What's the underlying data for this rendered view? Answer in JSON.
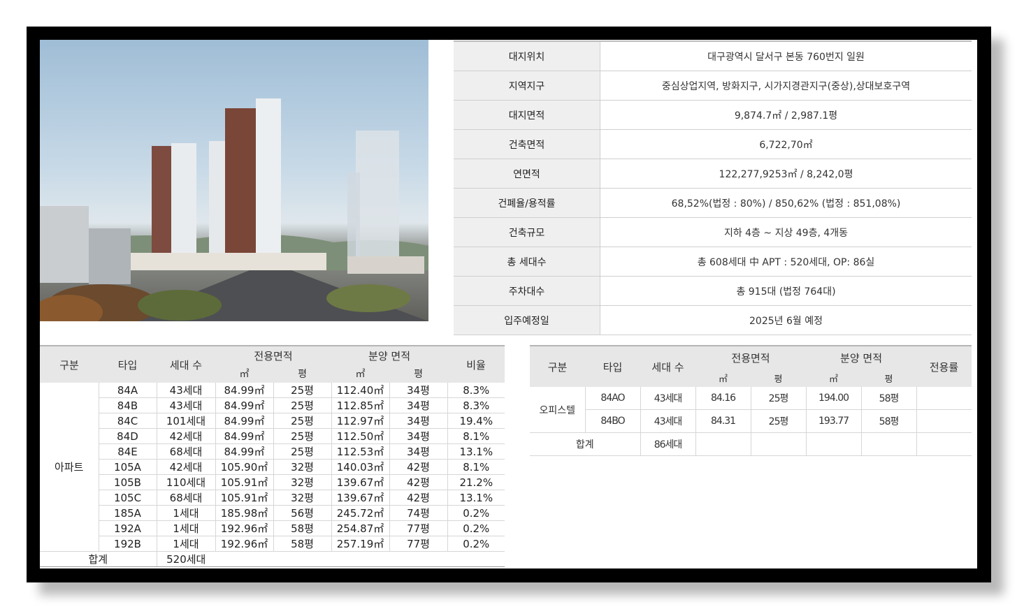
{
  "info_rows": [
    {
      "label": "대지위치",
      "value": "대구광역시 달서구 본동 760번지 일원"
    },
    {
      "label": "지역지구",
      "value": "중심상업지역, 방화지구, 시가지경관지구(중상),상대보호구역"
    },
    {
      "label": "대지면적",
      "value": "9,874.7㎡ / 2,987.1평"
    },
    {
      "label": "건축면적",
      "value": "6,722,70㎡"
    },
    {
      "label": "연면적",
      "value": "122,277,9253㎡ / 8,242,0평"
    },
    {
      "label": "건폐율/용적률",
      "value": "68,52%(법정 : 80%) / 850,62% (법정 : 851,08%)"
    },
    {
      "label": "건축규모",
      "value": "지하 4층 ~ 지상 49층, 4개동"
    },
    {
      "label": "총 세대수",
      "value": "총 608세대 中 APT : 520세대, OP: 86실"
    },
    {
      "label": "주차대수",
      "value": "총 915대 (법정 764대)"
    },
    {
      "label": "입주예정일",
      "value": "2025년 6월 예정"
    }
  ],
  "apt_table": {
    "headers": {
      "category": "구분",
      "type": "타입",
      "units": "세대 수",
      "exclusive": "전용면적",
      "supply": "분양 면적",
      "ratio": "비율",
      "sqm": "㎡",
      "pyeong": "평"
    },
    "group_label": "아파트",
    "rows": [
      [
        "84A",
        "43세대",
        "84.99㎡",
        "25평",
        "112.40㎡",
        "34평",
        "8.3%"
      ],
      [
        "84B",
        "43세대",
        "84.99㎡",
        "25평",
        "112.85㎡",
        "34평",
        "8.3%"
      ],
      [
        "84C",
        "101세대",
        "84.99㎡",
        "25평",
        "112.97㎡",
        "34평",
        "19.4%"
      ],
      [
        "84D",
        "42세대",
        "84.99㎡",
        "25평",
        "112.50㎡",
        "34평",
        "8.1%"
      ],
      [
        "84E",
        "68세대",
        "84.99㎡",
        "25평",
        "112.53㎡",
        "34평",
        "13.1%"
      ],
      [
        "105A",
        "42세대",
        "105.90㎡",
        "32평",
        "140.03㎡",
        "42평",
        "8.1%"
      ],
      [
        "105B",
        "110세대",
        "105.91㎡",
        "32평",
        "139.67㎡",
        "42평",
        "21.2%"
      ],
      [
        "105C",
        "68세대",
        "105.91㎡",
        "32평",
        "139.67㎡",
        "42평",
        "13.1%"
      ],
      [
        "185A",
        "1세대",
        "185.98㎡",
        "56평",
        "245.72㎡",
        "74평",
        "0.2%"
      ],
      [
        "192A",
        "1세대",
        "192.96㎡",
        "58평",
        "254.87㎡",
        "77평",
        "0.2%"
      ],
      [
        "192B",
        "1세대",
        "192.96㎡",
        "58평",
        "257.19㎡",
        "77평",
        "0.2%"
      ]
    ],
    "total_label": "합계",
    "total_units": "520세대"
  },
  "off_table": {
    "headers": {
      "category": "구분",
      "type": "타입",
      "units": "세대 수",
      "exclusive": "전용면적",
      "supply": "분양 면적",
      "ratio": "전용률",
      "sqm": "㎡",
      "pyeong": "평"
    },
    "group_label": "오피스텔",
    "rows": [
      [
        "84AO",
        "43세대",
        "84.16",
        "25평",
        "194.00",
        "58평",
        ""
      ],
      [
        "84BO",
        "43세대",
        "84.31",
        "25평",
        "193.77",
        "58평",
        ""
      ]
    ],
    "total_label": "합계",
    "total_units": "86세대"
  }
}
